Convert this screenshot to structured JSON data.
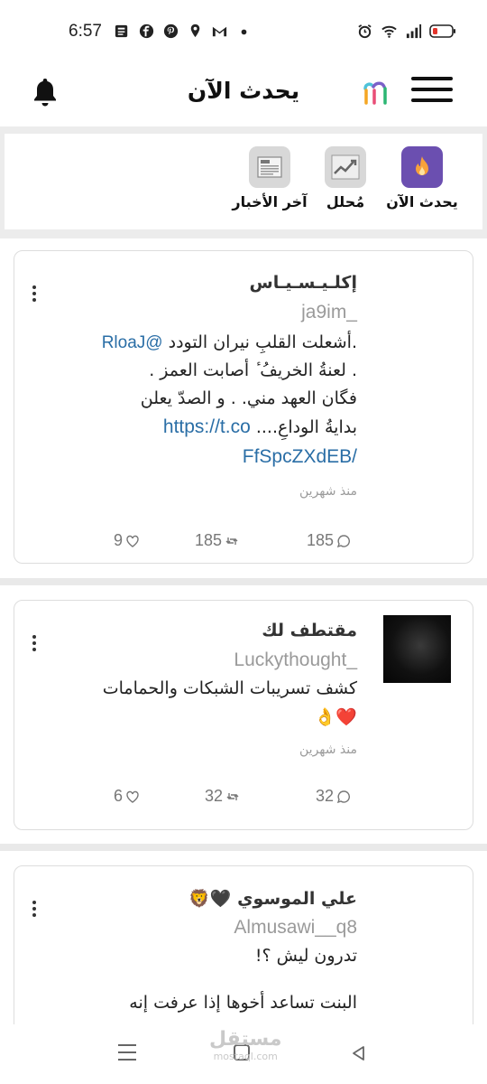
{
  "status_bar": {
    "time": "6:57",
    "left_icons": [
      "newspaper-icon",
      "facebook-icon",
      "pinterest-icon",
      "location-icon",
      "gmail-icon",
      "dot-icon"
    ],
    "right_icons": [
      "alarm-icon",
      "wifi-icon",
      "signal-icon",
      "battery-icon"
    ]
  },
  "header": {
    "title": "يحدث الآن",
    "logo_icon": "app-logo-icon",
    "bell_icon": "bell-icon",
    "menu_icon": "hamburger-menu-icon"
  },
  "categories": [
    {
      "label": "يحدث الآن",
      "icon": "fire-icon",
      "color": "#6b4fb0"
    },
    {
      "label": "مُحلل",
      "icon": "analysis-chart-icon",
      "color": "#d8d8d8"
    },
    {
      "label": "آخر الأخبار",
      "icon": "news-icon",
      "color": "#d8d8d8"
    }
  ],
  "posts": [
    {
      "author": "إكلـيـسـيـاس",
      "handle": "ja9im_",
      "lines": [
        {
          "text": ".أشعلت القلبِ نيران التودد ",
          "link": "@RloaJ"
        },
        {
          "text": ". لعنةُ الخريفُ ٔ أصابت العمز ."
        },
        {
          "text": "فگان العهد مني. . و الصدّ يعلن"
        },
        {
          "text": "بدايةُ الوداعِ.... ",
          "link": "https://t.co"
        },
        {
          "text": "",
          "link": "/FfSpcZXdEB"
        }
      ],
      "time": "منذ شهرين",
      "likes": "9",
      "retweets": "185",
      "replies": "185"
    },
    {
      "author": "مقتطف لك",
      "handle": "Luckythought_",
      "lines": [
        {
          "text": "كشف تسريبات الشبكات والحمامات"
        },
        {
          "text": "❤️👌"
        }
      ],
      "time": "منذ شهرين",
      "likes": "6",
      "retweets": "32",
      "replies": "32"
    },
    {
      "author": "علي الموسوي 🖤🦁",
      "handle": "Almusawi__q8",
      "lines": [
        {
          "text": "تدرون ليش ؟!"
        },
        {
          "text": ""
        },
        {
          "text": "البنت تساعد أخوها إذا عرفت إنه"
        }
      ]
    }
  ],
  "nav_bar": {
    "watermark": "مستقل",
    "watermark_sub": "mostaql.com"
  },
  "colors": {
    "link": "#2a6ea6",
    "accent_purple": "#6b4fb0",
    "separator": "#e9e9e9"
  }
}
